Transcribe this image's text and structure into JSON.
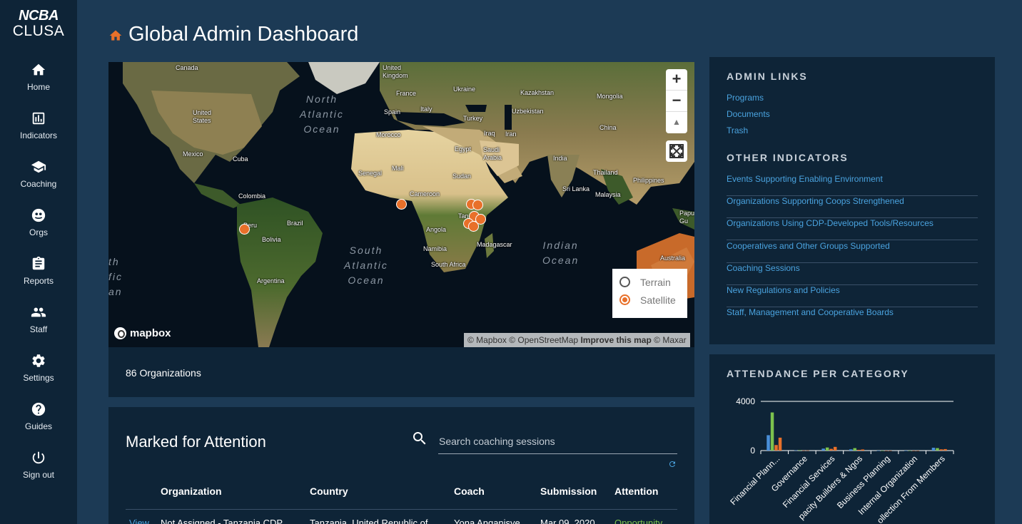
{
  "brand": {
    "line1": "NCBA",
    "line2": "CLUSA"
  },
  "nav": [
    {
      "label": "Home",
      "icon": "home-icon"
    },
    {
      "label": "Indicators",
      "icon": "chart-icon"
    },
    {
      "label": "Coaching",
      "icon": "graduation-cap-icon"
    },
    {
      "label": "Orgs",
      "icon": "globe-icon"
    },
    {
      "label": "Reports",
      "icon": "clipboard-icon"
    },
    {
      "label": "Staff",
      "icon": "people-icon"
    },
    {
      "label": "Settings",
      "icon": "gear-icon"
    },
    {
      "label": "Guides",
      "icon": "help-icon"
    },
    {
      "label": "Sign out",
      "icon": "power-icon"
    }
  ],
  "page": {
    "title": "Global Admin Dashboard",
    "title_icon": "home-icon",
    "accent": "#e8702a"
  },
  "map": {
    "labels": {
      "canada": "Canada",
      "uk": "United Kingdom",
      "ukraine": "Ukraine",
      "kazakhstan": "Kazakhstan",
      "mongolia": "Mongolia",
      "france": "France",
      "spain": "Spain",
      "italy": "Italy",
      "turkey": "Turkey",
      "uzbekistan": "Uzbekistan",
      "us": "United States",
      "morocco": "Morocco",
      "iraq": "Iraq",
      "iran": "Iran",
      "china": "China",
      "egypt": "Egypt",
      "saudi": "Saudi Arabia",
      "mexico": "Mexico",
      "cuba": "Cuba",
      "india": "India",
      "mali": "Mali",
      "senegal": "Senegal",
      "sudan": "Sudan",
      "thailand": "Thailand",
      "philippines": "Philippines",
      "srilanka": "Sri Lanka",
      "malaysia": "Malaysia",
      "colombia": "Colombia",
      "cameroon": "Cameroon",
      "brazil": "Brazil",
      "peru": "Peru",
      "angola": "Angola",
      "bolivia": "Bolivia",
      "madagascar": "Madagascar",
      "namibia": "Namibia",
      "southafrica": "South Africa",
      "argentina": "Argentina",
      "australia": "Australia",
      "papua": "Papu Gu",
      "tanzania": "Tan"
    },
    "oceans": {
      "north_atlantic": "North\nAtlantic\nOcean",
      "south_atlantic": "South\nAtlantic\nOcean",
      "indian": "Indian\nOcean",
      "pacific_partial": "th\nfic\nan"
    },
    "zoom_in": "+",
    "zoom_out": "−",
    "compass": "▲",
    "style_options": [
      "Terrain",
      "Satellite"
    ],
    "style_selected": "Satellite",
    "logo_text": "mapbox",
    "attribution": {
      "mapbox": "© Mapbox",
      "osm": "© OpenStreetMap",
      "improve": "Improve this map",
      "maxar": "© Maxar"
    },
    "org_count": "86 Organizations"
  },
  "attention": {
    "title": "Marked for Attention",
    "search_placeholder": "Search coaching sessions",
    "columns": [
      "Organization",
      "Country",
      "Coach",
      "Submission",
      "Attention"
    ],
    "rows": [
      {
        "action": "View",
        "organization": "Not Assigned - Tanzania CDP",
        "country": "Tanzania, United Republic of",
        "coach": "Yona Anganisye",
        "submission": "Mar 09, 2020",
        "attention": "Opportunity"
      }
    ]
  },
  "admin_links": {
    "heading": "ADMIN LINKS",
    "links": [
      "Programs",
      "Documents",
      "Trash"
    ]
  },
  "other_indicators": {
    "heading": "OTHER INDICATORS",
    "links": [
      "Events Supporting Enabling Environment",
      "Organizations Supporting Coops Strengthened",
      "Organizations Using CDP-Developed Tools/Resources",
      "Cooperatives and Other Groups Supported",
      "Coaching Sessions",
      "New Regulations and Policies",
      "Staff, Management and Cooperative Boards"
    ]
  },
  "attendance": {
    "heading": "ATTENDANCE PER CATEGORY"
  },
  "chart_data": {
    "type": "bar",
    "title": "ATTENDANCE PER CATEGORY",
    "categories": [
      "Financial Plann...",
      "Governance",
      "Financial Services",
      "Capacity Builders & Ngos",
      "Business Planning",
      "Internal Organization",
      "Collection From Members"
    ],
    "tick_labels": [
      "Financial Plann...",
      "Governance",
      "Financial Services",
      "pacity Builders & Ngos",
      "Business Planning",
      "Internal Organization",
      "ollection From Members"
    ],
    "series": [
      {
        "color": "#4a90d9",
        "values": [
          1250,
          20,
          160,
          100,
          0,
          0,
          230
        ]
      },
      {
        "color": "#7cc24d",
        "values": [
          3100,
          40,
          250,
          200,
          0,
          0,
          200
        ]
      },
      {
        "color": "#e8702a",
        "values": [
          450,
          10,
          140,
          60,
          0,
          0,
          100
        ]
      },
      {
        "color": "#e8702a",
        "values": [
          1050,
          15,
          300,
          90,
          0,
          0,
          120
        ]
      }
    ],
    "y_ticks": [
      "4000",
      "0"
    ],
    "ylim": [
      0,
      4000
    ],
    "grid": true
  }
}
